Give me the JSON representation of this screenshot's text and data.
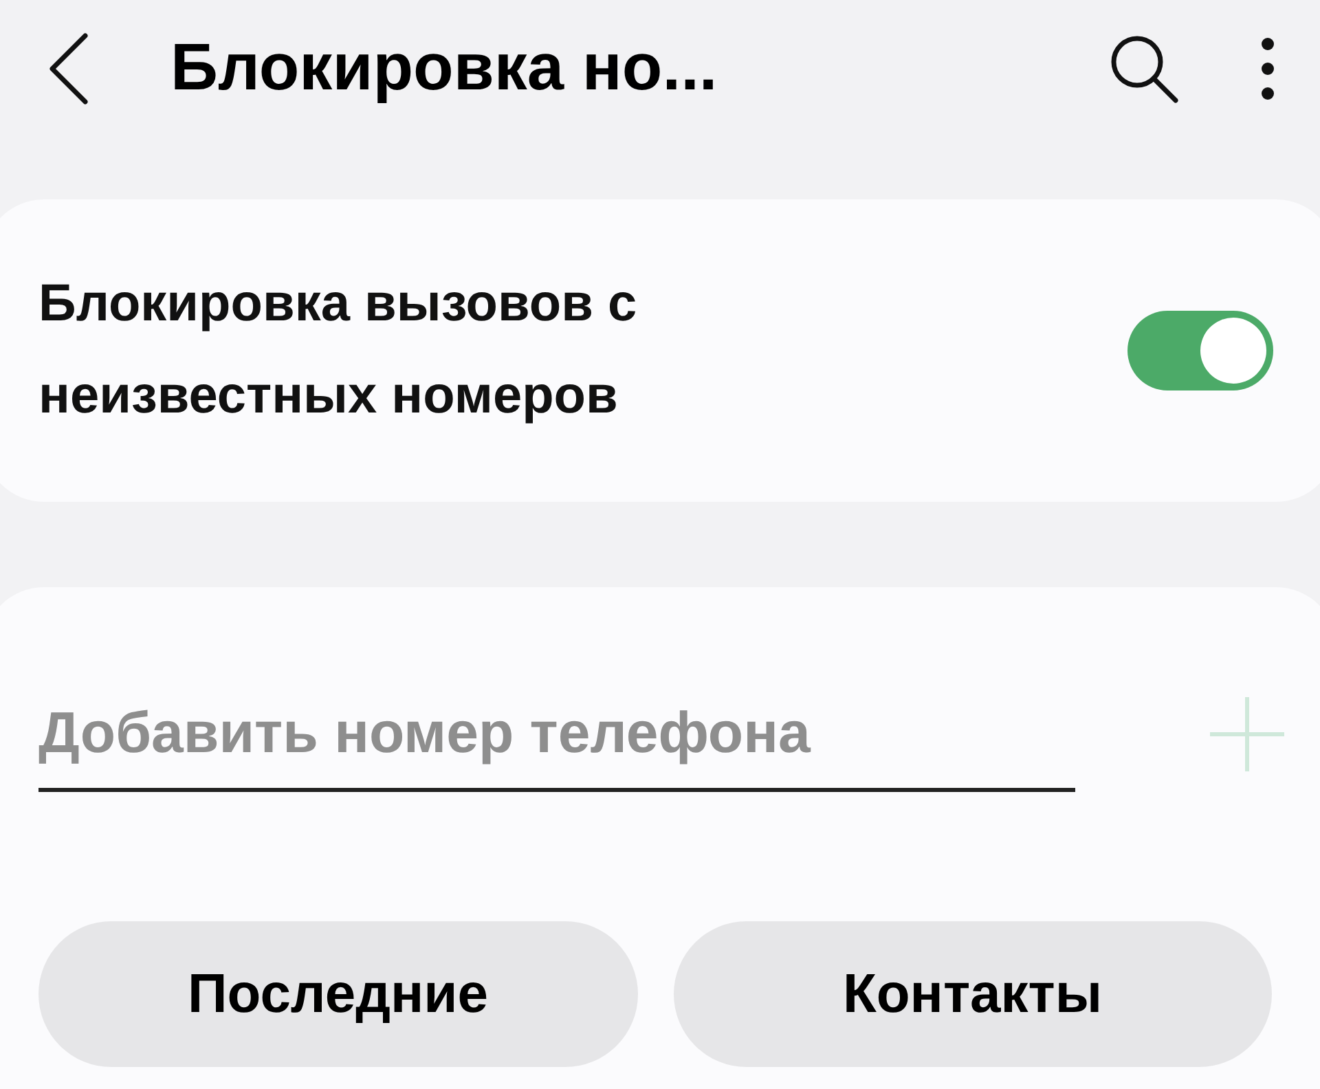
{
  "header": {
    "title": "Блокировка но..."
  },
  "unknown_calls": {
    "label": "Блокировка вызовов с неизвестных номеров",
    "on": true
  },
  "add_number": {
    "placeholder": "Добавить номер телефона"
  },
  "buttons": [
    "Последние",
    "Контакты"
  ]
}
